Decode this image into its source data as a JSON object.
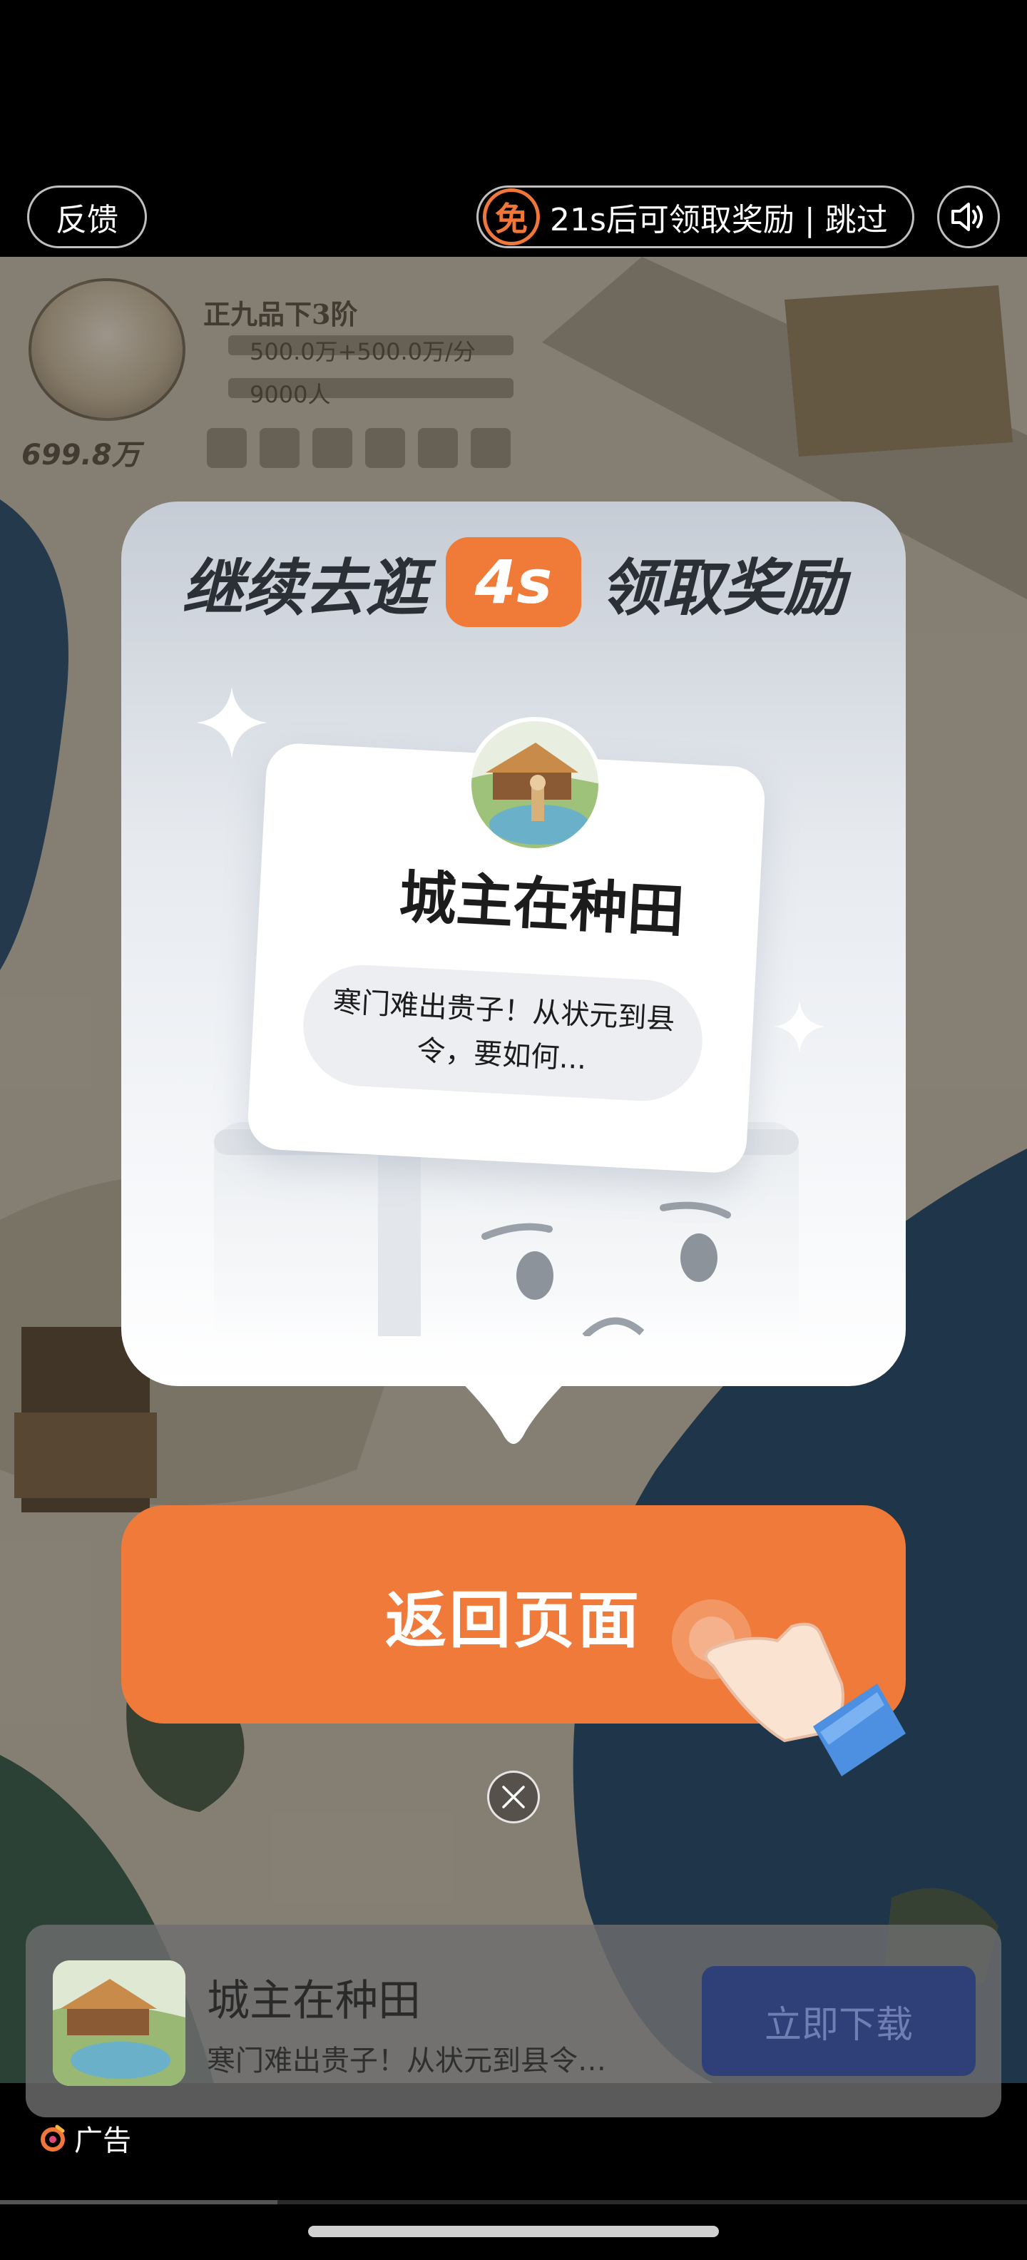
{
  "top_bar": {
    "feedback_label": "反馈",
    "free_icon_text": "免",
    "timer_text": "21s后可领取奖励 | 跳过",
    "sound_icon": "speaker-icon"
  },
  "game_hud": {
    "rank": "正九品下3阶",
    "income": "500.0万+500.0万/分",
    "population": "9000人",
    "money": "699.8万"
  },
  "promo": {
    "headline_prefix": "继续去逛",
    "countdown": "4s",
    "headline_suffix": "领取奖励",
    "game_name": "城主在种田",
    "tagline": "寒门难出贵子！从状元到县令，要如何..."
  },
  "return_button_label": "返回页面",
  "close_icon": "close-icon",
  "banner": {
    "app_name": "城主在种田",
    "app_desc": "寒门难出贵子！从状元到县令…",
    "download_label": "立即下载"
  },
  "ad_label": "广告",
  "video_progress": 0.27,
  "colors": {
    "accent": "#ef7a39",
    "download_button": "#2f3f78"
  }
}
